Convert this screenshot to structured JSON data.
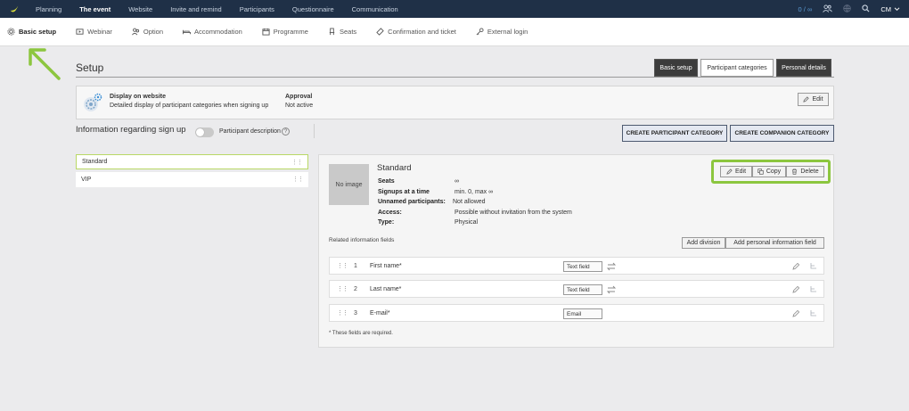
{
  "topnav": {
    "items": [
      "Planning",
      "The event",
      "Website",
      "Invite and remind",
      "Participants",
      "Questionnaire",
      "Communication"
    ],
    "active_index": 1,
    "count": "0 / ∞",
    "user": "CM"
  },
  "subnav": {
    "items": [
      {
        "label": "Basic setup",
        "icon": "gear-icon"
      },
      {
        "label": "Webinar",
        "icon": "video-icon"
      },
      {
        "label": "Option",
        "icon": "people-icon"
      },
      {
        "label": "Accommodation",
        "icon": "bed-icon"
      },
      {
        "label": "Programme",
        "icon": "calendar-icon"
      },
      {
        "label": "Seats",
        "icon": "seat-icon"
      },
      {
        "label": "Confirmation and ticket",
        "icon": "ticket-icon"
      },
      {
        "label": "External login",
        "icon": "key-icon"
      }
    ],
    "active_index": 0
  },
  "page": {
    "title": "Setup",
    "tabs": [
      "Basic setup",
      "Participant categories",
      "Personal details"
    ],
    "active_tab_index": 1
  },
  "infobox": {
    "display_label": "Display on website",
    "display_value": "Detailed display of participant categories when signing up",
    "approval_label": "Approval",
    "approval_value": "Not active",
    "edit_label": "Edit"
  },
  "signup": {
    "heading": "Information regarding sign up",
    "toggle_label": "Participant description",
    "help_glyph": "?",
    "create_participant_label": "CREATE PARTICIPANT CATEGORY",
    "create_companion_label": "CREATE COMPANION CATEGORY"
  },
  "categories": [
    {
      "name": "Standard",
      "selected": true
    },
    {
      "name": "VIP",
      "selected": false
    }
  ],
  "detail": {
    "noimage_label": "No image",
    "title": "Standard",
    "properties": [
      {
        "key": "Seats",
        "value": "∞"
      },
      {
        "key": "Signups at a time",
        "value": "min. 0, max ∞"
      },
      {
        "key": "Unnamed participants:",
        "value": "Not allowed"
      },
      {
        "key": "Access:",
        "value": "Possible without invitation from the system"
      },
      {
        "key": "Type:",
        "value": "Physical"
      }
    ],
    "actions": {
      "edit": "Edit",
      "copy": "Copy",
      "delete": "Delete"
    },
    "related_label": "Related information fields",
    "add_division_label": "Add division",
    "add_personal_label": "Add personal information field",
    "fields": [
      {
        "num": "1",
        "name": "First name*",
        "type": "Text field"
      },
      {
        "num": "2",
        "name": "Last name*",
        "type": "Text field"
      },
      {
        "num": "3",
        "name": "E-mail*",
        "type": "Email"
      }
    ],
    "required_note": "* These fields are required."
  },
  "colors": {
    "topbar": "#1f3047",
    "highlight": "#8cc63f",
    "selected_border": "#b9d866"
  }
}
